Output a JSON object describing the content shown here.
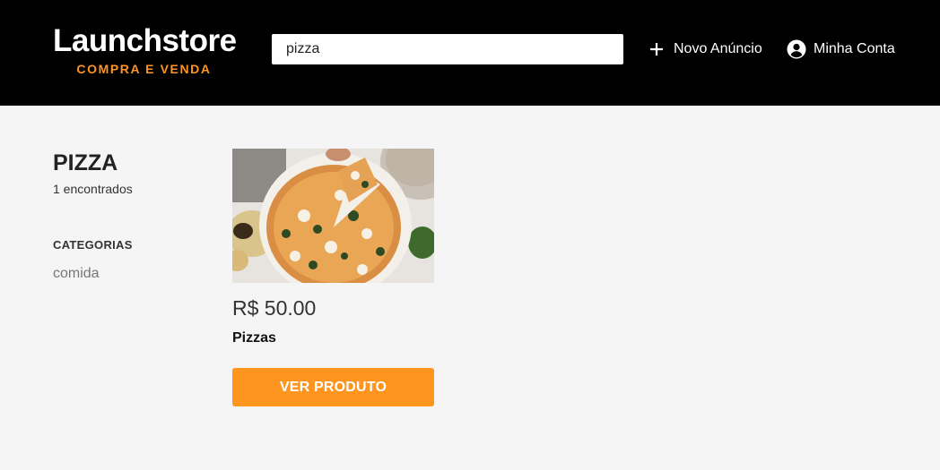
{
  "header": {
    "logo_title": "Launchstore",
    "logo_subtitle": "COMPRA E VENDA",
    "search_value": "pizza",
    "new_ad_label": "Novo Anúncio",
    "account_label": "Minha Conta"
  },
  "sidebar": {
    "search_term": "PIZZA",
    "found_text": "1 encontrados",
    "categories_heading": "CATEGORIAS",
    "categories": [
      "comida"
    ]
  },
  "products": [
    {
      "image_icon": "pizza-photo",
      "price": "R$ 50.00",
      "name": "Pizzas",
      "button_label": "VER PRODUTO"
    }
  ],
  "colors": {
    "header_bg": "#000000",
    "accent": "#fd951f",
    "page_bg": "#f5f5f5"
  }
}
